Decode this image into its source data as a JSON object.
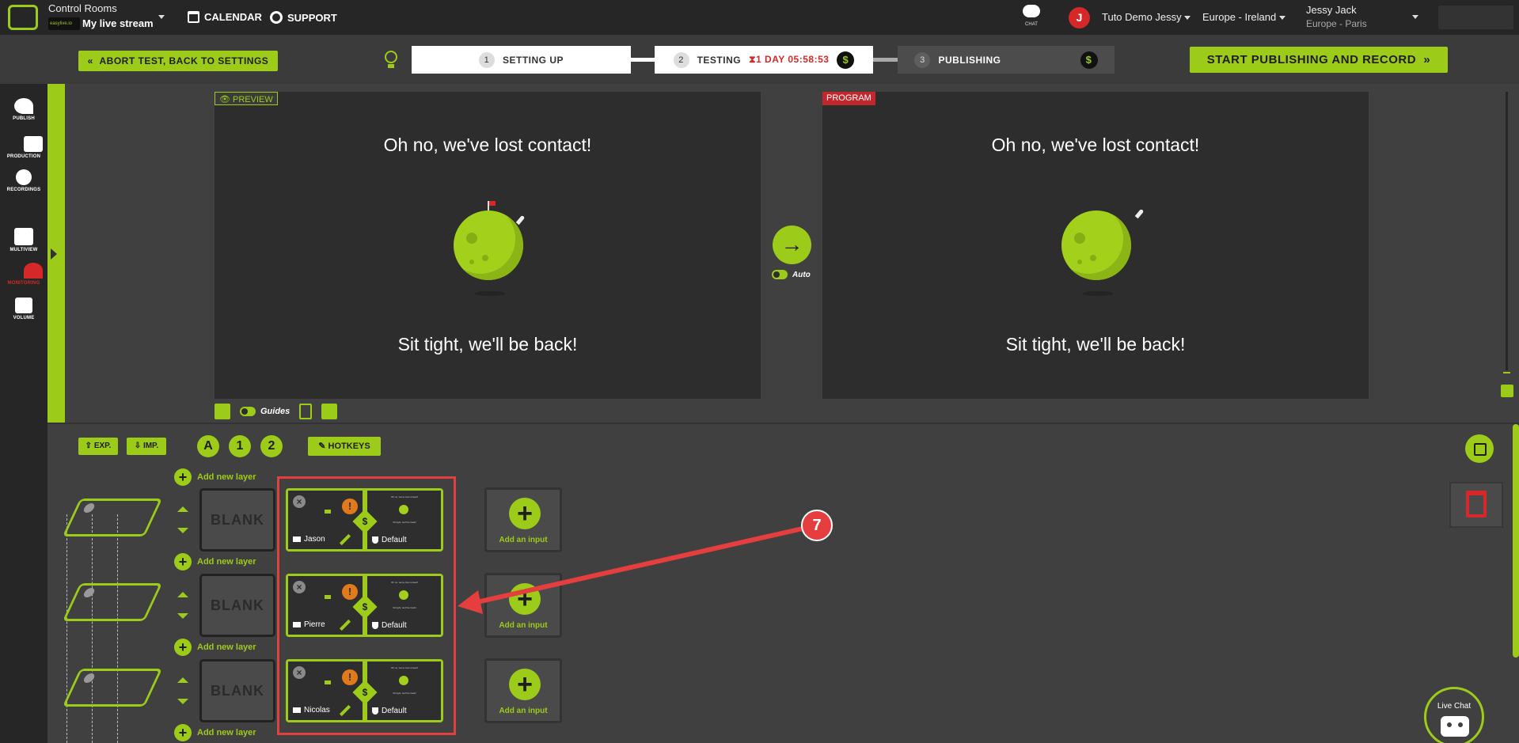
{
  "topbar": {
    "control_rooms": "Control Rooms",
    "brand_badge": "easylive.io",
    "stream_name": "My live stream",
    "calendar": "CALENDAR",
    "support": "SUPPORT",
    "chat": "CHAT",
    "avatar_initial": "J",
    "org": "Tuto Demo Jessy",
    "region": "Europe - Ireland",
    "user_name": "Jessy Jack",
    "user_tz": "Europe - Paris"
  },
  "stepbar": {
    "abort": "ABORT TEST, BACK TO SETTINGS",
    "step1_num": "1",
    "step1": "SETTING UP",
    "step2_num": "2",
    "step2": "TESTING",
    "timer": "1 DAY 05:58:53",
    "step3_num": "3",
    "step3": "PUBLISHING",
    "dollar": "$",
    "start": "START PUBLISHING AND RECORD"
  },
  "sidebar": {
    "publish": "PUBLISH",
    "production": "PRODUCTION",
    "recordings": "RECORDINGS",
    "multiview": "MULTIVIEW",
    "monitoring": "MONITORING",
    "volume": "VOLUME"
  },
  "preview": {
    "tag": "PREVIEW",
    "line1": "Oh no, we've lost contact!",
    "line2": "Sit tight, we'll be back!",
    "guides": "Guides"
  },
  "program": {
    "tag": "PROGRAM",
    "line1": "Oh no, we've lost contact!",
    "line2": "Sit tight, we'll be back!"
  },
  "transition": {
    "take": "→",
    "auto": "Auto"
  },
  "lower": {
    "exp": "EXP.",
    "imp": "IMP.",
    "tab_a": "A",
    "tab_1": "1",
    "tab_2": "2",
    "hotkeys": "HOTKEYS",
    "add_new_layer": "Add new layer",
    "blank": "BLANK",
    "add_input": "Add an input",
    "default": "Default",
    "mini_line1": "Oh no, we've lost contact!",
    "mini_line2": "Sit tight, we'll be back!",
    "sources": [
      {
        "name": "Jason"
      },
      {
        "name": "Pierre"
      },
      {
        "name": "Nicolas"
      }
    ]
  },
  "annotation": {
    "callout": "7",
    "color": "#e53e3e"
  },
  "live_chat": "Live Chat",
  "colors": {
    "accent": "#9ccb1a",
    "danger": "#d62828",
    "bg": "#404040"
  }
}
